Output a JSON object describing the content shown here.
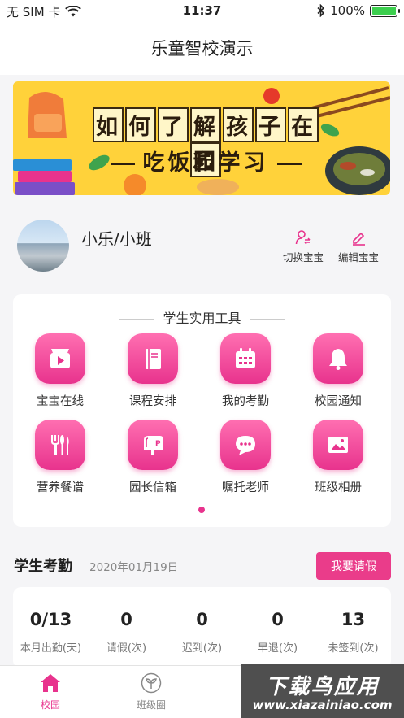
{
  "status_bar": {
    "carrier": "无 SIM 卡",
    "time": "11:37",
    "battery": "100%",
    "battery_level": 1.0
  },
  "header": {
    "title": "乐童智校演示"
  },
  "banner": {
    "line1_chars": [
      "如",
      "何",
      "了",
      "解",
      "孩",
      "子",
      "在",
      "园"
    ],
    "line2": "吃饭和学习",
    "bg_color": "#ffd23a"
  },
  "profile": {
    "name": "小乐/小班",
    "switch_label": "切换宝宝",
    "edit_label": "编辑宝宝"
  },
  "tools": {
    "title": "学生实用工具",
    "items": [
      {
        "label": "宝宝在线",
        "icon": "video-icon"
      },
      {
        "label": "课程安排",
        "icon": "book-icon"
      },
      {
        "label": "我的考勤",
        "icon": "calendar-icon"
      },
      {
        "label": "校园通知",
        "icon": "bell-icon"
      },
      {
        "label": "营养餐谱",
        "icon": "cutlery-icon"
      },
      {
        "label": "园长信箱",
        "icon": "mailbox-icon"
      },
      {
        "label": "嘱托老师",
        "icon": "chat-icon"
      },
      {
        "label": "班级相册",
        "icon": "photo-icon"
      }
    ],
    "page_count": 1,
    "current_page": 1
  },
  "attendance": {
    "title": "学生考勤",
    "date": "2020年01月19日",
    "leave_button": "我要请假",
    "stats": [
      {
        "value": "0/13",
        "label": "本月出勤(天)"
      },
      {
        "value": "0",
        "label": "请假(次)"
      },
      {
        "value": "0",
        "label": "迟到(次)"
      },
      {
        "value": "0",
        "label": "早退(次)"
      },
      {
        "value": "13",
        "label": "未签到(次)"
      }
    ]
  },
  "tabbar": {
    "tabs": [
      {
        "label": "校园",
        "active": true
      },
      {
        "label": "班级圈",
        "active": false
      }
    ]
  },
  "watermark": {
    "line1": "下载鸟应用",
    "line2": "www.xiazainiao.com"
  },
  "colors": {
    "accent": "#e8338d",
    "battery": "#3ccf4e"
  }
}
